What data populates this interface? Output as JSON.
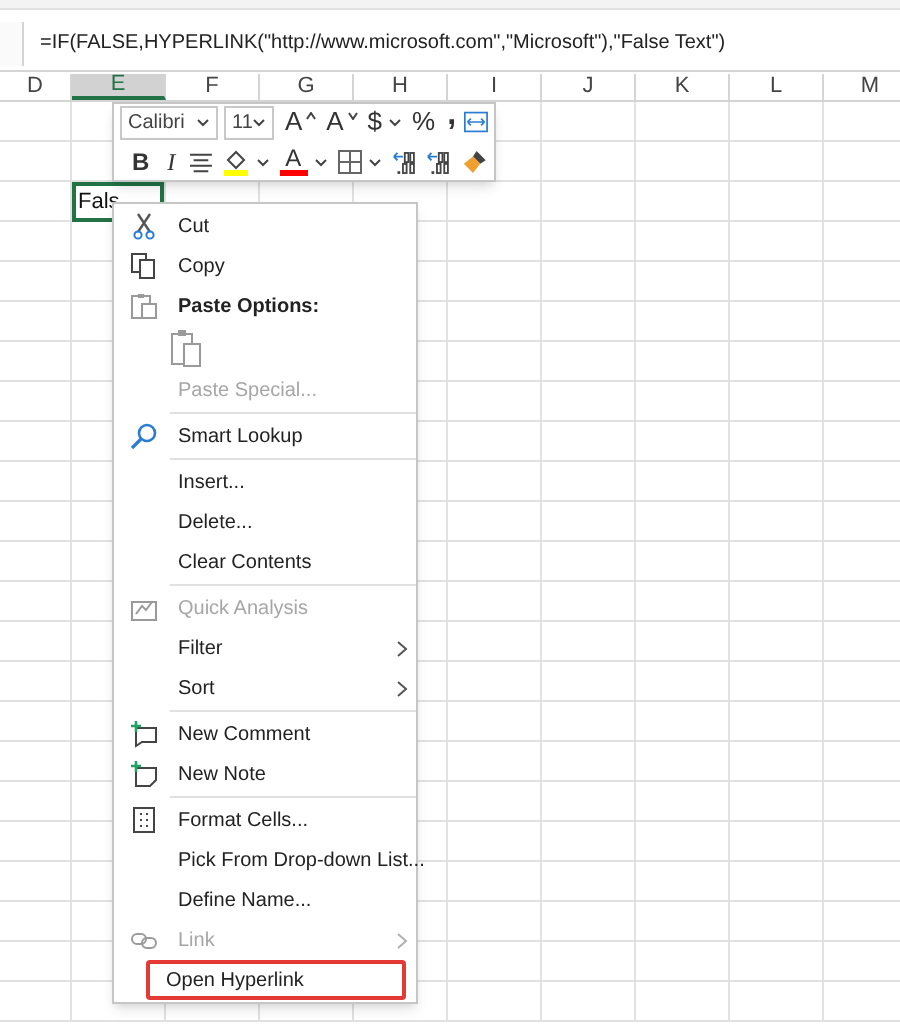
{
  "formula_bar": {
    "formula": "=IF(FALSE,HYPERLINK(\"http://www.microsoft.com\",\"Microsoft\"),\"False Text\")"
  },
  "columns": [
    {
      "label": "D",
      "selected": false
    },
    {
      "label": "E",
      "selected": true
    },
    {
      "label": "F",
      "selected": false
    },
    {
      "label": "G",
      "selected": false
    },
    {
      "label": "H",
      "selected": false
    },
    {
      "label": "I",
      "selected": false
    },
    {
      "label": "J",
      "selected": false
    },
    {
      "label": "K",
      "selected": false
    },
    {
      "label": "L",
      "selected": false
    },
    {
      "label": "M",
      "selected": false
    }
  ],
  "active_cell": {
    "text": "Fals"
  },
  "mini_toolbar": {
    "top_row": [
      {
        "kind": "font",
        "label": "Calibri"
      },
      {
        "kind": "size",
        "label": "11"
      },
      {
        "kind": "grow",
        "label": "A"
      },
      {
        "kind": "shrink",
        "label": "A"
      },
      {
        "kind": "currency",
        "label": "$"
      },
      {
        "kind": "percent",
        "label": "%"
      },
      {
        "kind": "comma",
        "label": ","
      },
      {
        "kind": "wrap"
      }
    ],
    "bottom_row": [
      {
        "kind": "bold",
        "label": "B"
      },
      {
        "kind": "italic",
        "label": "I"
      },
      {
        "kind": "align"
      },
      {
        "kind": "fill"
      },
      {
        "kind": "fontcolor",
        "label": "A"
      },
      {
        "kind": "borders"
      },
      {
        "kind": "decdec"
      },
      {
        "kind": "incdec"
      },
      {
        "kind": "clear"
      }
    ]
  },
  "context_menu": {
    "items": [
      {
        "kind": "item",
        "label": "Cut",
        "disabled": false,
        "submenu": false,
        "boxed": false
      },
      {
        "kind": "item",
        "label": "Copy",
        "disabled": false,
        "submenu": false,
        "boxed": false
      },
      {
        "kind": "header",
        "label": "Paste Options:"
      },
      {
        "kind": "paste"
      },
      {
        "kind": "item",
        "label": "Paste Special...",
        "disabled": true,
        "submenu": false,
        "boxed": false
      },
      {
        "kind": "separator"
      },
      {
        "kind": "item",
        "label": "Smart Lookup",
        "disabled": false,
        "submenu": false,
        "boxed": false
      },
      {
        "kind": "separator"
      },
      {
        "kind": "item",
        "label": "Insert...",
        "disabled": false,
        "submenu": false,
        "boxed": false
      },
      {
        "kind": "item",
        "label": "Delete...",
        "disabled": false,
        "submenu": false,
        "boxed": false
      },
      {
        "kind": "item",
        "label": "Clear Contents",
        "disabled": false,
        "submenu": false,
        "boxed": false
      },
      {
        "kind": "separator"
      },
      {
        "kind": "item",
        "label": "Quick Analysis",
        "disabled": true,
        "submenu": false,
        "boxed": false
      },
      {
        "kind": "item",
        "label": "Filter",
        "disabled": false,
        "submenu": true,
        "boxed": false
      },
      {
        "kind": "item",
        "label": "Sort",
        "disabled": false,
        "submenu": true,
        "boxed": false
      },
      {
        "kind": "separator"
      },
      {
        "kind": "item",
        "label": "New Comment",
        "disabled": false,
        "submenu": false,
        "boxed": false
      },
      {
        "kind": "item",
        "label": "New Note",
        "disabled": false,
        "submenu": false,
        "boxed": false
      },
      {
        "kind": "separator"
      },
      {
        "kind": "item",
        "label": "Format Cells...",
        "disabled": false,
        "submenu": false,
        "boxed": false
      },
      {
        "kind": "item",
        "label": "Pick From Drop-down List...",
        "disabled": false,
        "submenu": false,
        "boxed": false
      },
      {
        "kind": "item",
        "label": "Define Name...",
        "disabled": false,
        "submenu": false,
        "boxed": false
      },
      {
        "kind": "item",
        "label": "Link",
        "disabled": true,
        "submenu": true,
        "boxed": false
      },
      {
        "kind": "item",
        "label": "Open Hyperlink",
        "disabled": false,
        "submenu": false,
        "boxed": true
      }
    ]
  }
}
